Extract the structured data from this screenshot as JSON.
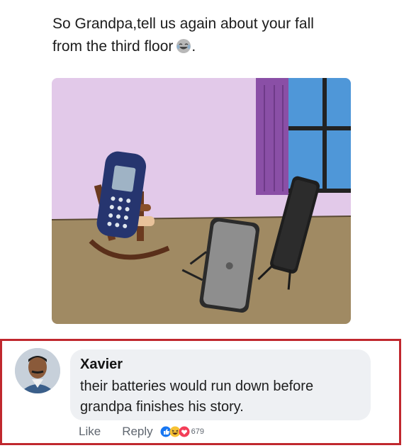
{
  "post": {
    "text_line1": "So Grandpa,tell us again about your fall",
    "text_line2": "from the third floor",
    "text_suffix": ".",
    "emoji_icon": "laughing-tears-icon",
    "image_icon": "cartoon-phones-image"
  },
  "comment": {
    "author": "Xavier",
    "text_line1": "their batteries would run down before",
    "text_line2": "grandpa finishes his story.",
    "avatar_icon": "avatar-man",
    "reactions": [
      "like-reaction-icon",
      "haha-reaction-icon",
      "love-reaction-icon"
    ],
    "reaction_count": "679"
  },
  "actions": {
    "like_label": "Like",
    "reply_label": "Reply"
  },
  "colors": {
    "highlight_border": "#c0282e",
    "wall": "#e2c9e9",
    "floor": "#a08a63",
    "bubble": "#eef0f3"
  }
}
